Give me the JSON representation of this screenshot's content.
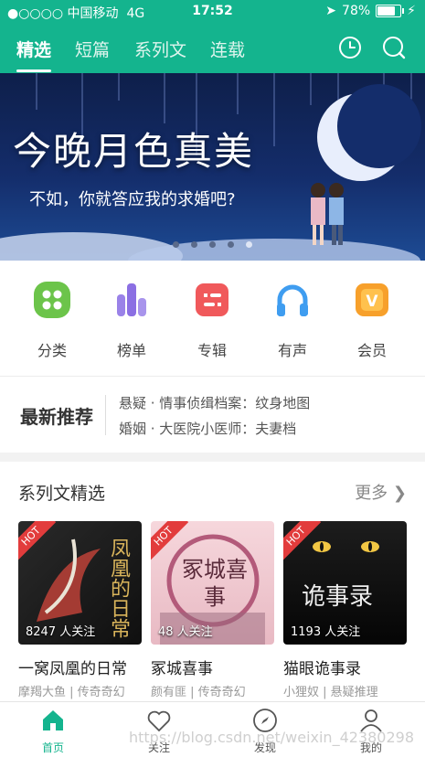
{
  "status": {
    "carrier": "●○○○○ 中国移动",
    "network": "4G",
    "time": "17:52",
    "battery": "78%",
    "battery_level": 0.78
  },
  "tabs": [
    "精选",
    "短篇",
    "系列文",
    "连载"
  ],
  "banner": {
    "title": "今晚月色真美",
    "subtitle": "不如，你就答应我的求婚吧?"
  },
  "categories": [
    {
      "label": "分类",
      "icon": "grid-icon",
      "color": "#6cc44a"
    },
    {
      "label": "榜单",
      "icon": "bar-chart-icon",
      "color": "#9a82e8"
    },
    {
      "label": "专辑",
      "icon": "album-icon",
      "color": "#f0595b"
    },
    {
      "label": "有声",
      "icon": "headphones-icon",
      "color": "#3f9df0"
    },
    {
      "label": "会员",
      "icon": "vip-icon",
      "color": "#f7a02b"
    }
  ],
  "recommend": {
    "heading": "最新推荐",
    "items": [
      "悬疑 · 情事侦缉档案：纹身地图",
      "婚姻 · 大医院小医师：夫妻档"
    ]
  },
  "series": {
    "heading": "系列文精选",
    "more": "更多 ❯",
    "books": [
      {
        "title": "一窝凤凰的日常",
        "meta": "摩羯大鱼 | 传奇奇幻",
        "followers": "8247 人关注",
        "badge": "HOT",
        "cover_text": "凤凰的日常"
      },
      {
        "title": "冢城喜事",
        "meta": "颜有匪 | 传奇奇幻",
        "followers": "48 人关注",
        "badge": "HOT",
        "cover_text": "冢城喜事"
      },
      {
        "title": "猫眼诡事录",
        "meta": "小狸奴 | 悬疑推理",
        "followers": "1193 人关注",
        "badge": "HOT",
        "cover_text": "诡事录"
      }
    ]
  },
  "bottom_nav": [
    "首页",
    "关注",
    "发现",
    "我的"
  ],
  "watermark": "https://blog.csdn.net/weixin_42380298",
  "colors": {
    "brand": "#14b48e"
  }
}
